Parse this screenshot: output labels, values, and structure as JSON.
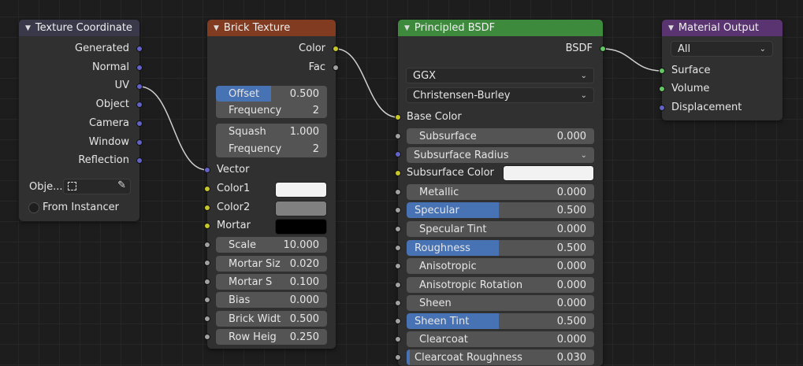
{
  "colors": {
    "texture_header": "#39394a",
    "brick_header": "#803b20",
    "bsdf_header": "#3d8a3d",
    "output_header": "#5a3470",
    "vector_socket": "#6363c7",
    "color_socket": "#c7c729",
    "float_socket": "#a1a1a1",
    "shader_socket": "#63c763",
    "slider_fill": "#4772b3"
  },
  "texcoord": {
    "title": "Texture Coordinate",
    "outputs": [
      "Generated",
      "Normal",
      "UV",
      "Object",
      "Camera",
      "Window",
      "Reflection"
    ],
    "object_label": "Obje...",
    "object_icon": "object-icon",
    "picker_icon": "eyedropper-icon",
    "from_instancer": "From Instancer"
  },
  "brick": {
    "title": "Brick Texture",
    "out_color": "Color",
    "out_fac": "Fac",
    "offset_label": "Offset",
    "offset_value": "0.500",
    "offset_fraction": 0.5,
    "offset_freq_label": "Frequency",
    "offset_freq_value": "2",
    "squash_label": "Squash",
    "squash_value": "1.000",
    "squash_freq_label": "Frequency",
    "squash_freq_value": "2",
    "in_vector": "Vector",
    "in_color1": "Color1",
    "in_color2": "Color2",
    "in_mortar": "Mortar",
    "color1": "#f2f2f2",
    "color2": "#808080",
    "mortar": "#000000",
    "params": [
      {
        "label": "Scale",
        "value": "10.000"
      },
      {
        "label": "Mortar Siz",
        "value": "0.020"
      },
      {
        "label": "Mortar S",
        "value": "0.100"
      },
      {
        "label": "Bias",
        "value": "0.000"
      },
      {
        "label": "Brick Widt",
        "value": "0.500"
      },
      {
        "label": "Row Heig",
        "value": "0.250"
      }
    ]
  },
  "bsdf": {
    "title": "Principled BSDF",
    "out_bsdf": "BSDF",
    "distribution": "GGX",
    "subsurface_method": "Christensen-Burley",
    "base_color": "Base Color",
    "subsurface_label": "Subsurface",
    "subsurface_value": "0.000",
    "subsurface_radius": "Subsurface Radius",
    "subsurface_color": "Subsurface Color",
    "subsurface_color_value": "#f2f2f2",
    "params": [
      {
        "label": "Metallic",
        "value": "0.000",
        "fraction": 0
      },
      {
        "label": "Specular",
        "value": "0.500",
        "fraction": 0.5
      },
      {
        "label": "Specular Tint",
        "value": "0.000",
        "fraction": 0
      },
      {
        "label": "Roughness",
        "value": "0.500",
        "fraction": 0.5
      },
      {
        "label": "Anisotropic",
        "value": "0.000",
        "fraction": 0
      },
      {
        "label": "Anisotropic Rotation",
        "value": "0.000",
        "fraction": 0
      },
      {
        "label": "Sheen",
        "value": "0.000",
        "fraction": 0
      },
      {
        "label": "Sheen Tint",
        "value": "0.500",
        "fraction": 0.5
      },
      {
        "label": "Clearcoat",
        "value": "0.000",
        "fraction": 0
      },
      {
        "label": "Clearcoat Roughness",
        "value": "0.030",
        "fraction": 0.03
      }
    ]
  },
  "output": {
    "title": "Material Output",
    "target": "All",
    "inputs": [
      "Surface",
      "Volume",
      "Displacement"
    ]
  }
}
